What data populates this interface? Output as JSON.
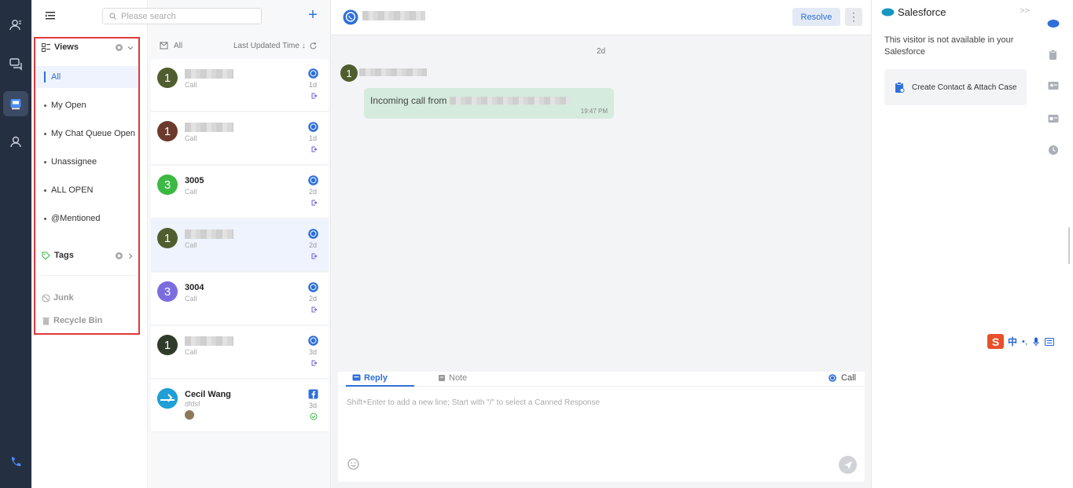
{
  "search": {
    "placeholder": "Please search"
  },
  "views_panel": {
    "views_header": "Views",
    "items": [
      {
        "label": "All",
        "active": true
      },
      {
        "label": "My Open"
      },
      {
        "label": "My Chat Queue Open"
      },
      {
        "label": "Unassignee"
      },
      {
        "label": "ALL OPEN"
      },
      {
        "label": "@Mentioned"
      }
    ],
    "tags_header": "Tags",
    "junk": "Junk",
    "recycle_bin": "Recycle Bin"
  },
  "list_header": {
    "filter": "All",
    "sort": "Last Updated Time ↓"
  },
  "conversations": [
    {
      "avatar_letter": "1",
      "avatar_color": "#4f5d2f",
      "name": "",
      "sub": "Call",
      "channel": "whatsapp",
      "time": "1d"
    },
    {
      "avatar_letter": "1",
      "avatar_color": "#6b3a2c",
      "name": "",
      "sub": "Call",
      "channel": "whatsapp",
      "time": "1d"
    },
    {
      "avatar_letter": "3",
      "avatar_color": "#3cb844",
      "name": "3005",
      "sub": "Call",
      "channel": "whatsapp",
      "time": "2d"
    },
    {
      "avatar_letter": "1",
      "avatar_color": "#4f5d2f",
      "name": "",
      "sub": "Call",
      "channel": "whatsapp",
      "time": "2d",
      "selected": true
    },
    {
      "avatar_letter": "3",
      "avatar_color": "#7b6de0",
      "name": "3004",
      "sub": "Call",
      "channel": "whatsapp",
      "time": "2d"
    },
    {
      "avatar_letter": "1",
      "avatar_color": "#2f3c2a",
      "name": "",
      "sub": "Call",
      "channel": "whatsapp",
      "time": "3d"
    },
    {
      "avatar_letter": "",
      "avatar_color": "#1f9fd6",
      "name": "Cecil Wang",
      "sub": "dfdsf",
      "channel": "facebook",
      "time": "3d"
    }
  ],
  "chat": {
    "resolve_label": "Resolve",
    "kebab": "⋮",
    "day_label": "2d",
    "avatar_letter": "1",
    "message_prefix": "Incoming call from",
    "message_time": "19:47 PM"
  },
  "composer": {
    "reply_tab": "Reply",
    "note_tab": "Note",
    "call_label": "Call",
    "placeholder": "Shift+Enter to add a new line; Start with \"/\" to select a Canned Response"
  },
  "salesforce": {
    "title": "Salesforce",
    "collapse": ">>",
    "message": "This visitor is not available in your Salesforce",
    "action": "Create Contact & Attach Case"
  },
  "ime": {
    "logo": "S",
    "lang": "中"
  },
  "colors": {
    "accent": "#2f6fd8",
    "rail": "#252f42",
    "highlight_border": "#e03a3a",
    "bubble": "#d5ebdd"
  }
}
